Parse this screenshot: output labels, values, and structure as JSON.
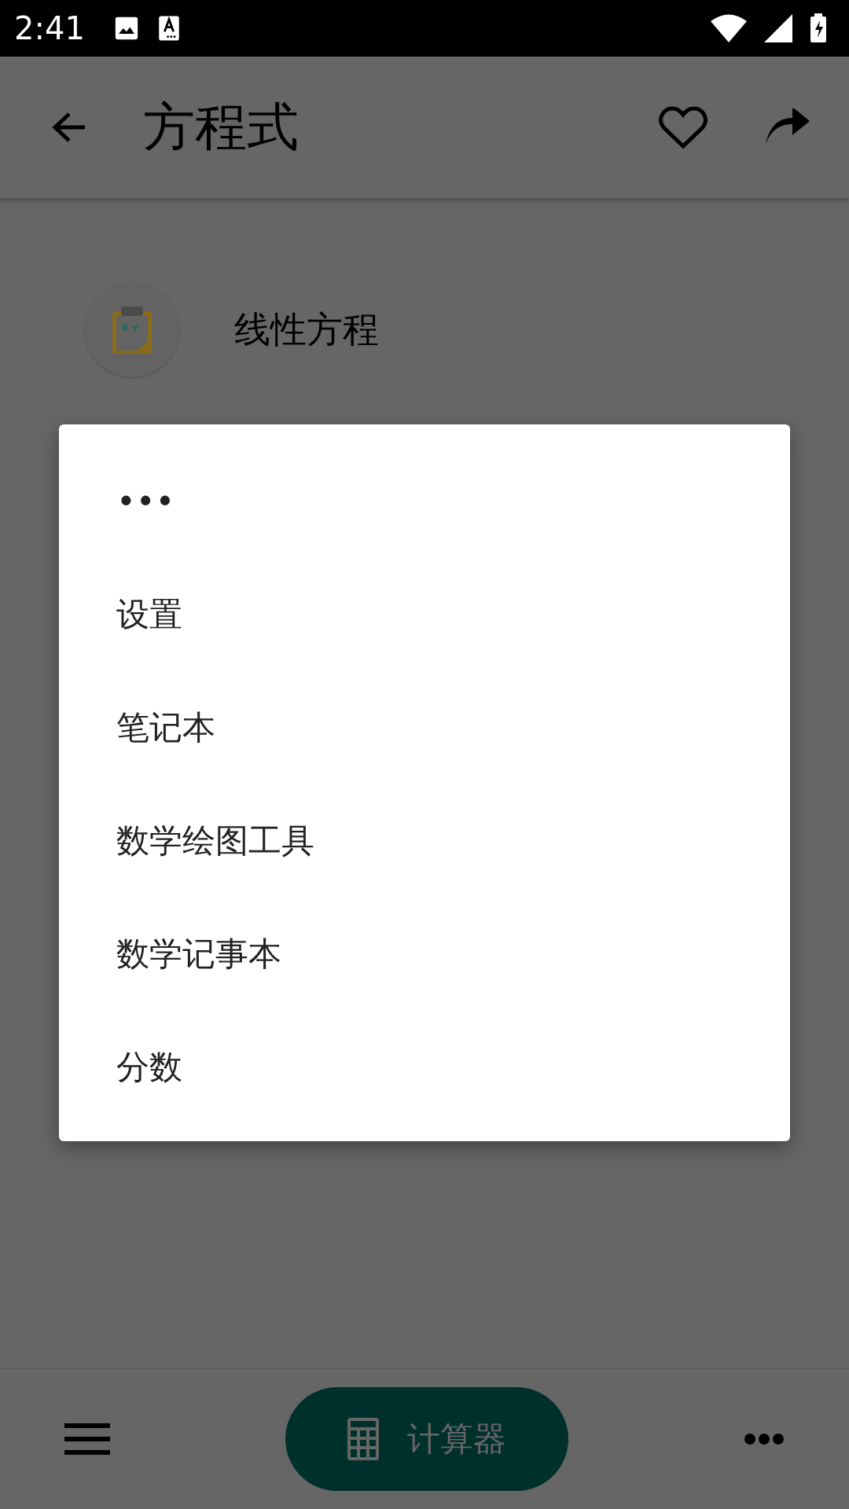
{
  "status_bar": {
    "time": "2:41"
  },
  "app_bar": {
    "title": "方程式"
  },
  "list": [
    {
      "label": "线性方程"
    }
  ],
  "menu": {
    "items": [
      {
        "label": "•••"
      },
      {
        "label": "设置"
      },
      {
        "label": "笔记本"
      },
      {
        "label": "数学绘图工具"
      },
      {
        "label": "数学记事本"
      },
      {
        "label": "分数"
      }
    ]
  },
  "bottom_bar": {
    "button": "计算器"
  }
}
